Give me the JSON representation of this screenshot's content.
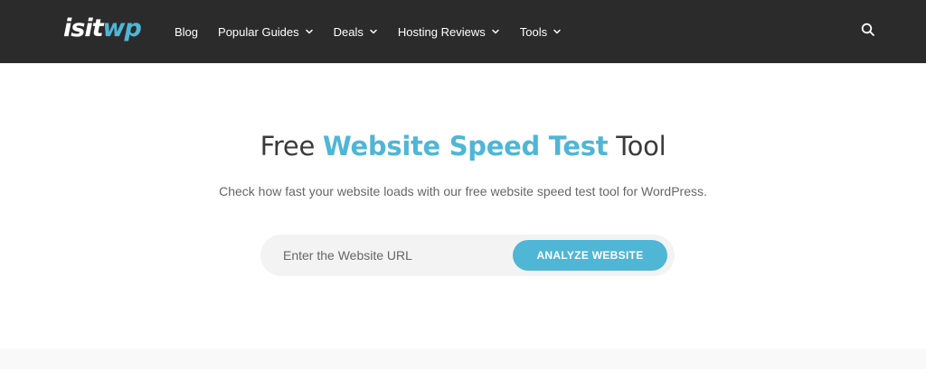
{
  "brand": {
    "logo_part1": "isit",
    "logo_part2": "wp",
    "colors": {
      "nav_bg": "#2b2b2b",
      "accent": "#4fb6d6",
      "text_dark": "#3a3a3a",
      "text_muted": "#666666"
    }
  },
  "nav": {
    "items": [
      {
        "label": "Blog",
        "has_dropdown": false
      },
      {
        "label": "Popular Guides",
        "has_dropdown": true
      },
      {
        "label": "Deals",
        "has_dropdown": true
      },
      {
        "label": "Hosting Reviews",
        "has_dropdown": true
      },
      {
        "label": "Tools",
        "has_dropdown": true
      }
    ],
    "search_icon": "search-icon",
    "dropdown_icon": "chevron-down-icon"
  },
  "hero": {
    "title_before": "Free ",
    "title_accent": "Website Speed Test",
    "title_after": " Tool",
    "subtitle": "Check how fast your website loads with our free website speed test tool for WordPress.",
    "form": {
      "url_placeholder": "Enter the Website URL",
      "url_value": "",
      "submit_label": "ANALYZE WEBSITE"
    }
  }
}
